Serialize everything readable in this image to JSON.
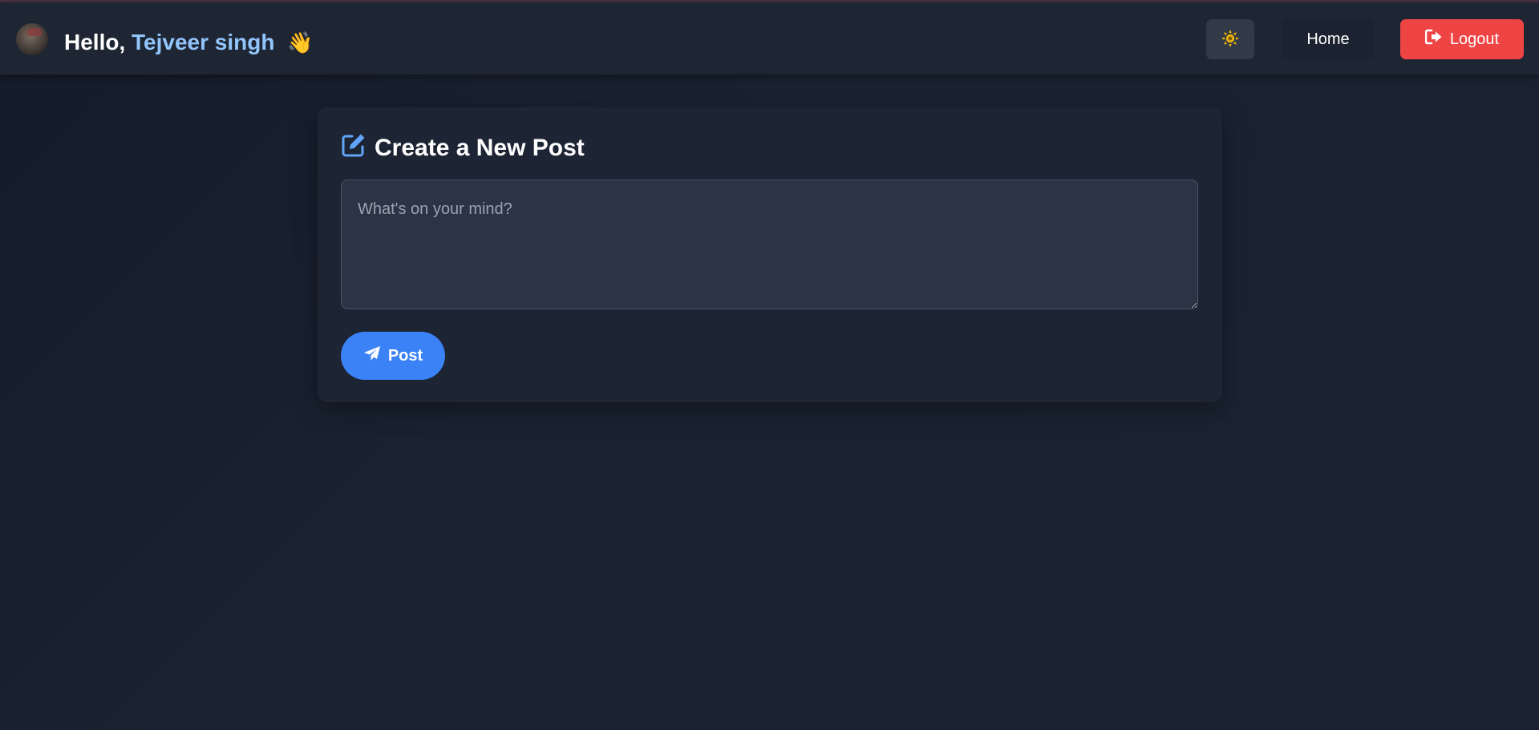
{
  "header": {
    "greeting_prefix": "Hello,",
    "user_name": "Tejveer singh",
    "wave_emoji": "👋",
    "theme_icon": "sun-icon",
    "home_label": "Home",
    "logout_label": "Logout",
    "logout_icon": "logout-icon"
  },
  "composer": {
    "title": "Create a New Post",
    "title_icon": "edit-icon",
    "placeholder": "What's on your mind?",
    "value": "",
    "post_label": "Post",
    "post_icon": "paper-plane-icon"
  },
  "colors": {
    "accent": "#3b82f6",
    "name_highlight": "#93c5fd",
    "logout": "#ef4444",
    "sun": "#eab308"
  }
}
